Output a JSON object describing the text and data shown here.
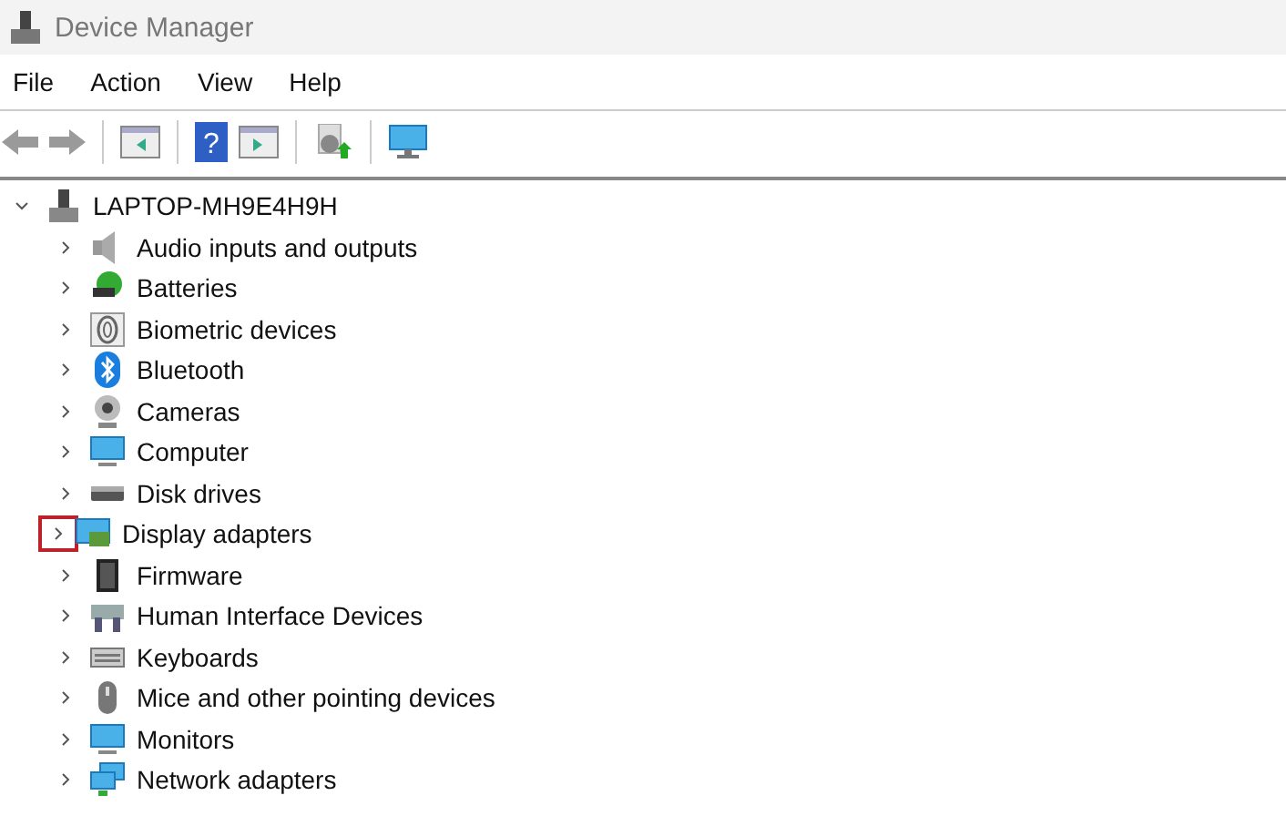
{
  "window": {
    "title": "Device Manager"
  },
  "menu": [
    "File",
    "Action",
    "View",
    "Help"
  ],
  "tree": {
    "label": "LAPTOP-MH9E4H9H",
    "expanded": true,
    "children": [
      {
        "label": "Audio inputs and outputs",
        "expanded": false,
        "highlighted": false
      },
      {
        "label": "Batteries",
        "expanded": false,
        "highlighted": false
      },
      {
        "label": "Biometric devices",
        "expanded": false,
        "highlighted": false
      },
      {
        "label": "Bluetooth",
        "expanded": false,
        "highlighted": false
      },
      {
        "label": "Cameras",
        "expanded": false,
        "highlighted": false
      },
      {
        "label": "Computer",
        "expanded": false,
        "highlighted": false
      },
      {
        "label": "Disk drives",
        "expanded": false,
        "highlighted": false
      },
      {
        "label": "Display adapters",
        "expanded": false,
        "highlighted": true
      },
      {
        "label": "Firmware",
        "expanded": false,
        "highlighted": false
      },
      {
        "label": "Human Interface Devices",
        "expanded": false,
        "highlighted": false
      },
      {
        "label": "Keyboards",
        "expanded": false,
        "highlighted": false
      },
      {
        "label": "Mice and other pointing devices",
        "expanded": false,
        "highlighted": false
      },
      {
        "label": "Monitors",
        "expanded": false,
        "highlighted": false
      },
      {
        "label": "Network adapters",
        "expanded": false,
        "highlighted": false
      }
    ]
  },
  "toolbar": {
    "help_glyph": "?"
  }
}
